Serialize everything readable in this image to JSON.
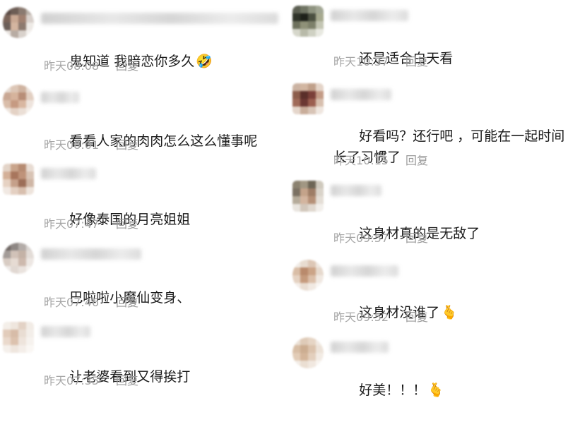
{
  "reply_label": "回复",
  "left_column": [
    {
      "text": "鬼知道 我暗恋你多久",
      "emoji": "🤣",
      "time": "昨天08:08"
    },
    {
      "text": "看看人家的肉肉怎么这么懂事呢",
      "emoji": "",
      "time": "昨天08:01"
    },
    {
      "text": "好像泰国的月亮姐姐",
      "emoji": "",
      "time": "昨天07:47"
    },
    {
      "text": "巴啦啦小魔仙变身、",
      "emoji": "",
      "time": "昨天07:46"
    },
    {
      "text": "让老婆看到又得挨打",
      "emoji": "",
      "time": "昨天07:35"
    }
  ],
  "right_column": [
    {
      "text": "还是适合白天看",
      "emoji": "",
      "time": "昨天10:37"
    },
    {
      "text": "好看吗？还行吧 ，可能在一起时间长了习惯了",
      "emoji": "",
      "time": "昨天10:15"
    },
    {
      "text": "这身材真的是无敌了",
      "emoji": "",
      "time": "昨天09:57"
    },
    {
      "text": "这身材没谁了",
      "emoji": "🫰",
      "time": "昨天09:52"
    },
    {
      "text": "好美！！！",
      "emoji": "🫰",
      "time": ""
    }
  ]
}
